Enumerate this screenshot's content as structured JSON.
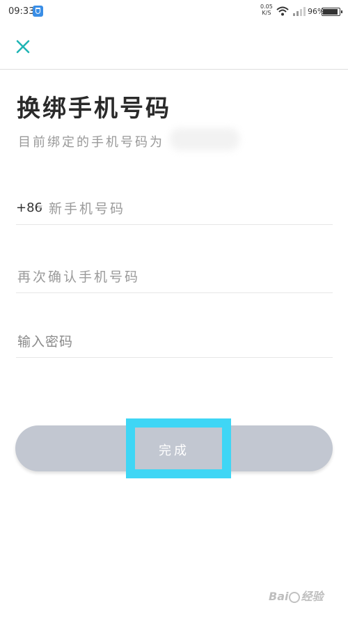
{
  "status_bar": {
    "time": "09:33",
    "net_speed_value": "0.05",
    "net_speed_unit": "K/S",
    "battery_percent": "96%",
    "app_icon": "shield-icon"
  },
  "header": {
    "close_icon": "close-icon",
    "accent_color": "#1fb5b5"
  },
  "page": {
    "title": "换绑手机号码",
    "subtitle": "目前绑定的手机号码为"
  },
  "form": {
    "country_code": "+86",
    "new_phone_placeholder": "新手机号码",
    "confirm_phone_placeholder": "再次确认手机号码",
    "password_placeholder": "输入密码",
    "submit_label": "完成",
    "button_color": "#c2c7d1",
    "highlight_color": "#3fd6f5"
  },
  "watermark": {
    "text": "Bai经验"
  }
}
